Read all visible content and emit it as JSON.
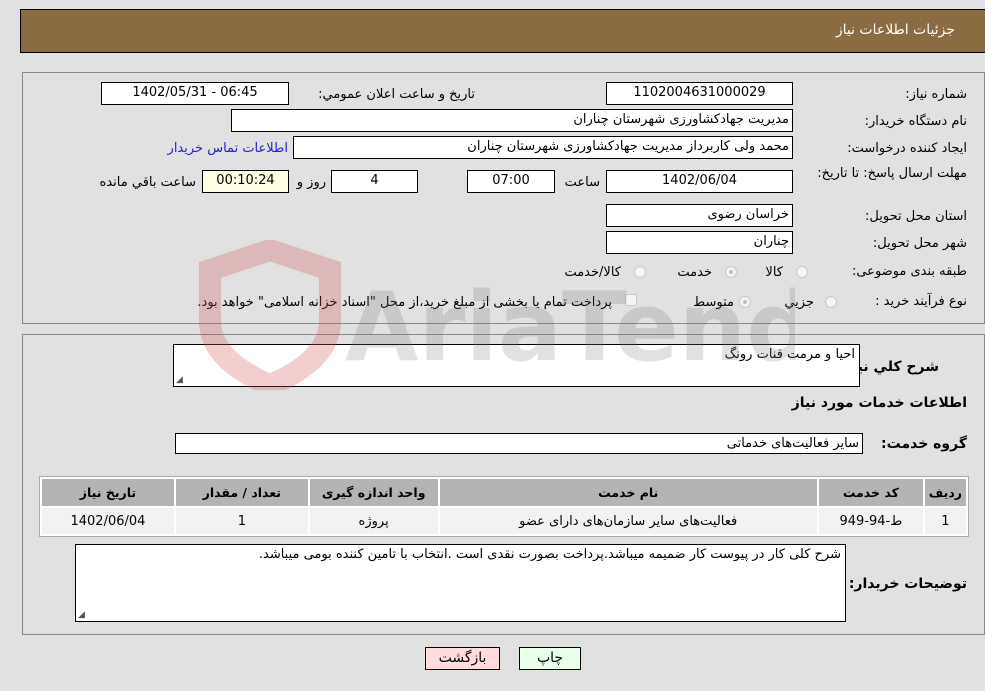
{
  "header": {
    "title": "جزئیات اطلاعات نیاز"
  },
  "form": {
    "need_number": {
      "label": "شماره نیاز:",
      "value": "1102004631000029"
    },
    "announce_datetime": {
      "label": "تاریخ و ساعت اعلان عمومي:",
      "value": "1402/05/31 - 06:45"
    },
    "buyer_org": {
      "label": "نام دستگاه خریدار:",
      "value": "مدیریت جهادکشاورزی شهرستان چناران"
    },
    "requester": {
      "label": "ایجاد کننده درخواست:",
      "value": "محمد ولی کاربرداز مدیریت جهادکشاورزی شهرستان چناران"
    },
    "buyer_contact_link": "اطلاعات تماس خریدار",
    "deadline": {
      "label": "مهلت ارسال پاسخ: تا تاریخ:",
      "date": "1402/06/04",
      "time_label": "ساعت",
      "time": "07:00",
      "days": "4",
      "days_label": "روز و",
      "remaining": "00:10:24",
      "remaining_label": "ساعت باقي مانده"
    },
    "province": {
      "label": "استان محل تحویل:",
      "value": "خراسان رضوی"
    },
    "city": {
      "label": "شهر محل تحویل:",
      "value": "چناران"
    },
    "category": {
      "label": "طبقه بندی موضوعی:",
      "options": [
        {
          "label": "کالا",
          "checked": false
        },
        {
          "label": "خدمت",
          "checked": true
        },
        {
          "label": "کالا/خدمت",
          "checked": false
        }
      ]
    },
    "purchase_process": {
      "label": "نوع فرآیند خرید :",
      "options": [
        {
          "label": "جزيي",
          "checked": false
        },
        {
          "label": "متوسط",
          "checked": true
        }
      ],
      "treasury_checkbox": {
        "label": "پرداخت تمام یا بخشی از مبلغ خرید،از محل \"اسناد خزانه اسلامی\" خواهد بود.",
        "checked": false
      }
    }
  },
  "details": {
    "general_desc_label": "شرح كلي نياز:",
    "general_desc_value": "احیا و مرمت قنات رونگ",
    "services_info_title": "اطلاعات خدمات مورد نیاز",
    "service_group_label": "گروه خدمت:",
    "service_group_value": "سایر فعالیت‌های خدماتی",
    "table": {
      "headers": [
        "ردیف",
        "کد خدمت",
        "نام خدمت",
        "واحد اندازه گیری",
        "تعداد / مقدار",
        "تاریخ نیاز"
      ],
      "rows": [
        [
          "1",
          "ط-94-949",
          "فعالیت‌های سایر سازمان‌های دارای عضو",
          "پروژه",
          "1",
          "1402/06/04"
        ]
      ]
    },
    "buyer_notes_label": "توضیحات خریدار:",
    "buyer_notes_value": "شرح کلی کار در پیوست کار ضمیمه میباشد.پرداخت بصورت نقدی است .انتخاب با تامین کننده بومی میباشد."
  },
  "buttons": {
    "print": "چاپ",
    "back": "بازگشت"
  },
  "colors": {
    "header": "#8b6b41",
    "print_btn": "#eaffea",
    "back_btn": "#ffdddd",
    "link": "#2222cc"
  }
}
